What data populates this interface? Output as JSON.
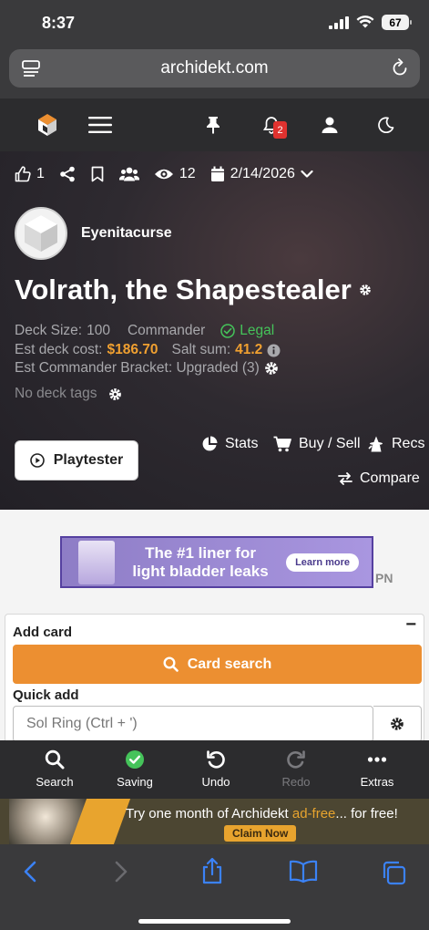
{
  "status": {
    "time": "8:37",
    "battery": "67"
  },
  "browser": {
    "url": "archidekt.com"
  },
  "nav": {
    "notification_count": "2"
  },
  "deck": {
    "likes": "1",
    "views": "12",
    "date": "2/14/2026",
    "owner": "Eyenitacurse",
    "title": "Volrath, the Shapestealer",
    "size_label": "Deck Size:",
    "size_value": "100",
    "format": "Commander",
    "legality": "Legal",
    "cost_label": "Est deck cost:",
    "cost_value": "$186.70",
    "salt_label": "Salt sum:",
    "salt_value": "41.2",
    "bracket_label": "Est Commander Bracket: Upgraded (3)",
    "tags_label": "No deck tags"
  },
  "actions": {
    "playtester": "Playtester",
    "stats": "Stats",
    "buy_sell": "Buy / Sell",
    "recs": "Recs",
    "compare": "Compare"
  },
  "ad": {
    "headline_line1": "The #1 liner for",
    "headline_line2": "light bladder leaks",
    "button": "Learn more",
    "mark": "PN"
  },
  "add_card": {
    "title": "Add card",
    "collapse": "−",
    "search_button": "Card search",
    "quick_add_label": "Quick add",
    "quick_add_placeholder": "Sol Ring (Ctrl + ')"
  },
  "toolbar": {
    "search": "Search",
    "saving": "Saving",
    "undo": "Undo",
    "redo": "Redo",
    "extras": "Extras"
  },
  "promo": {
    "text_before": "Try one month of Archidekt ",
    "text_highlight": "ad-free",
    "text_after": "... for free!",
    "button": "Claim Now"
  },
  "colors": {
    "accent": "#EC8F31",
    "legal_green": "#45C35A",
    "badge_red": "#E0322F"
  }
}
